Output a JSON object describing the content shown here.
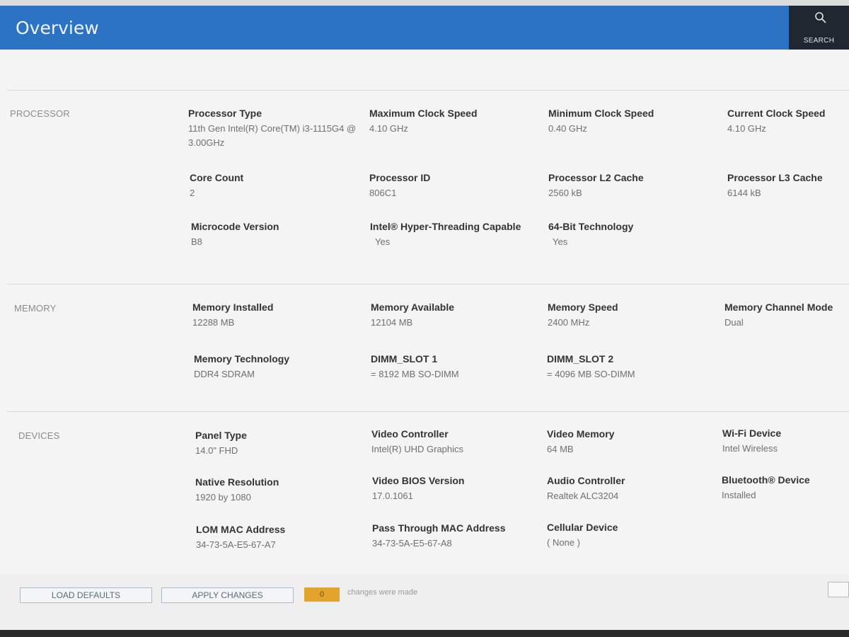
{
  "header": {
    "title": "Overview",
    "search_label": "SEARCH"
  },
  "sections": {
    "processor": {
      "title": "PROCESSOR",
      "fields": [
        {
          "label": "Processor Type",
          "value": "11th Gen Intel(R) Core(TM) i3-1115G4 @ 3.00GHz"
        },
        {
          "label": "Maximum Clock Speed",
          "value": "4.10 GHz"
        },
        {
          "label": "Minimum Clock Speed",
          "value": "0.40 GHz"
        },
        {
          "label": "Current Clock Speed",
          "value": "4.10 GHz"
        },
        {
          "label": "Core Count",
          "value": "2"
        },
        {
          "label": "Processor ID",
          "value": "806C1"
        },
        {
          "label": "Processor L2 Cache",
          "value": "2560 kB"
        },
        {
          "label": "Processor L3 Cache",
          "value": "6144 kB"
        },
        {
          "label": "Microcode Version",
          "value": "B8"
        },
        {
          "label": "Intel® Hyper-Threading Capable",
          "value": "Yes"
        },
        {
          "label": "64-Bit Technology",
          "value": "Yes"
        }
      ]
    },
    "memory": {
      "title": "MEMORY",
      "fields": [
        {
          "label": "Memory Installed",
          "value": "12288 MB"
        },
        {
          "label": "Memory Available",
          "value": "12104 MB"
        },
        {
          "label": "Memory Speed",
          "value": "2400 MHz"
        },
        {
          "label": "Memory Channel Mode",
          "value": "Dual"
        },
        {
          "label": "Memory Technology",
          "value": "DDR4 SDRAM"
        },
        {
          "label": "DIMM_SLOT 1",
          "value": "= 8192 MB SO-DIMM"
        },
        {
          "label": "DIMM_SLOT 2",
          "value": "= 4096 MB SO-DIMM"
        }
      ]
    },
    "devices": {
      "title": "DEVICES",
      "fields": [
        {
          "label": "Panel Type",
          "value": "14.0\" FHD"
        },
        {
          "label": "Video Controller",
          "value": "Intel(R) UHD Graphics"
        },
        {
          "label": "Video Memory",
          "value": "64 MB"
        },
        {
          "label": "Wi-Fi Device",
          "value": "Intel Wireless"
        },
        {
          "label": "Native Resolution",
          "value": "1920 by 1080"
        },
        {
          "label": "Video BIOS Version",
          "value": "17.0.1061"
        },
        {
          "label": "Audio Controller",
          "value": "Realtek ALC3204"
        },
        {
          "label": "Bluetooth® Device",
          "value": "Installed"
        },
        {
          "label": "LOM MAC Address",
          "value": "34-73-5A-E5-67-A7"
        },
        {
          "label": "Pass Through MAC Address",
          "value": "34-73-5A-E5-67-A8"
        },
        {
          "label": "Cellular Device",
          "value": "( None )"
        }
      ]
    }
  },
  "footer": {
    "load_defaults": "LOAD DEFAULTS",
    "apply_changes": "APPLY CHANGES",
    "changes_count": "0",
    "changes_text": "changes were made"
  }
}
